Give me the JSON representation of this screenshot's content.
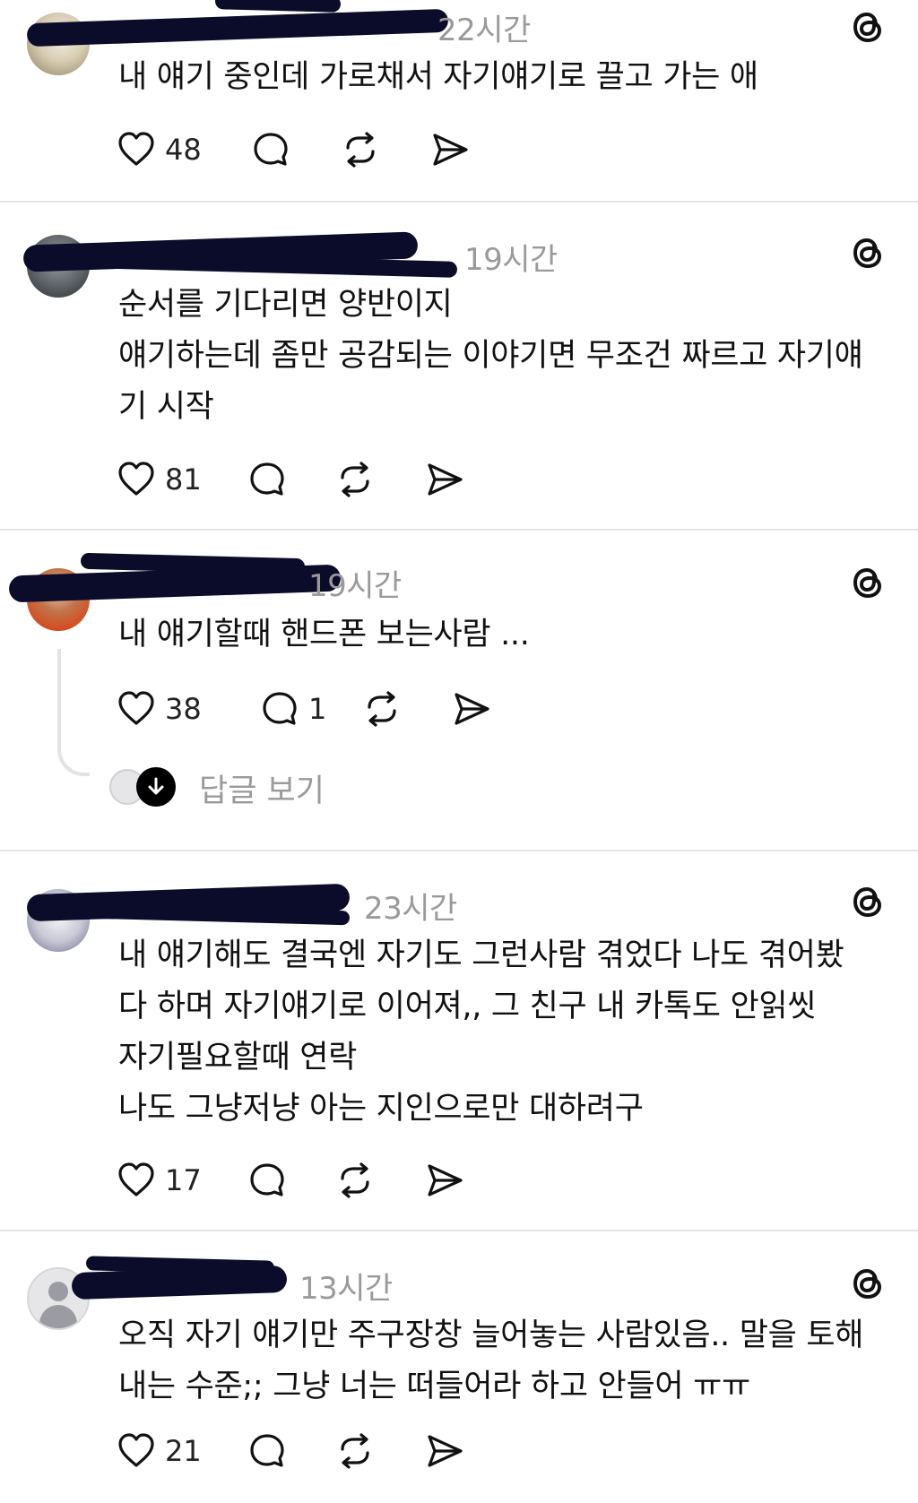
{
  "posts": [
    {
      "timestamp": "22시간",
      "lines": [
        "내 얘기 중인데 가로채서 자기얘기로 끌고 가는 애"
      ],
      "likes": "48",
      "replies": ""
    },
    {
      "timestamp": "19시간",
      "lines": [
        "순서를 기다리면 양반이지",
        "얘기하는데 좀만 공감되는 이야기면 무조건 짜르고 자기얘",
        "기 시작"
      ],
      "likes": "81",
      "replies": ""
    },
    {
      "timestamp": "19시간",
      "lines": [
        "내 얘기할때 핸드폰 보는사람 ..."
      ],
      "likes": "38",
      "replies": "1",
      "view_replies_label": "답글 보기"
    },
    {
      "timestamp": "23시간",
      "lines": [
        "내 얘기해도 결국엔 자기도 그런사람 겪었다 나도 겪어봤",
        "다 하며 자기얘기로 이어져,, 그 친구 내 카톡도 안읽씻",
        "자기필요할때 연락",
        "나도 그냥저냥 아는 지인으로만 대하려구"
      ],
      "likes": "17",
      "replies": ""
    },
    {
      "timestamp": "13시간",
      "lines": [
        "오직 자기 얘기만 주구장창 늘어놓는 사람있음.. 말을 토해",
        "내는 수준;; 그냥 너는 떠들어라 하고 안들어 ㅠㅠ"
      ],
      "likes": "21",
      "replies": ""
    }
  ],
  "icons": {
    "like": "heart-icon",
    "reply": "comment-icon",
    "repost": "repost-icon",
    "share": "share-icon",
    "brand": "threads-icon"
  }
}
